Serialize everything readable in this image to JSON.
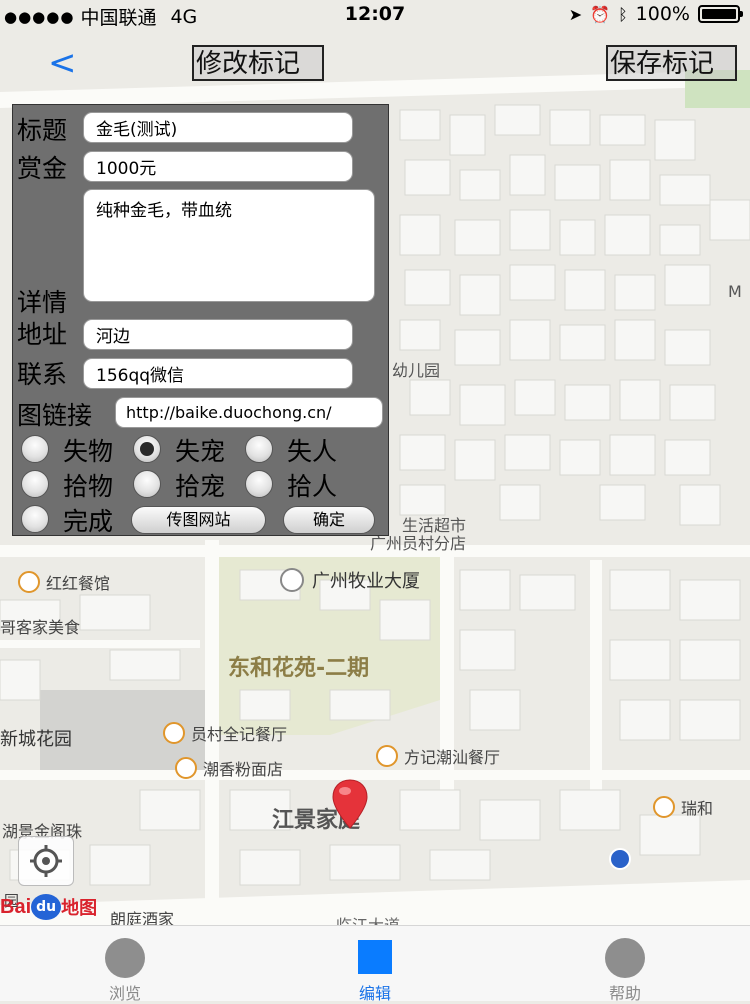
{
  "status_bar": {
    "carrier": "中国联通",
    "network": "4G",
    "time": "12:07",
    "battery": "100%"
  },
  "nav": {
    "back_label": "<",
    "modify_label": "修改标记",
    "save_label": "保存标记"
  },
  "form": {
    "title_label": "标题",
    "title_value": "金毛(测试)",
    "reward_label": "赏金",
    "reward_value": "1000元",
    "detail_label": "详情",
    "detail_value": "纯种金毛，带血统",
    "address_label": "地址",
    "address_value": "河边",
    "contact_label": "联系",
    "contact_value": "156qq微信",
    "image_link_label": "图链接",
    "image_link_value": "http://baike.duochong.cn/",
    "radio_options": [
      "失物",
      "失宠",
      "失人",
      "拾物",
      "拾宠",
      "拾人",
      "完成"
    ],
    "selected_option": "失宠",
    "upload_button": "传图网站",
    "confirm_button": "确定"
  },
  "map": {
    "labels": {
      "kindergarten": "幼儿园",
      "supermarket_1": "生活超市",
      "supermarket_2": "广州员村分店",
      "honghong": "红红餐馆",
      "building": "广州牧业大厦",
      "hakka": "哥客家美食",
      "donghe": "东和花苑-二期",
      "xincheng": "新城花园",
      "quanji": "员村全记餐厅",
      "fangji": "方记潮汕餐厅",
      "chaoxiang": "潮香粉面店",
      "jiangjing": "江景家庭",
      "ruihe": "瑞和",
      "hujing": "湖景金阁珠",
      "tingjiujia": "朗庭酒家",
      "road": "临江大道",
      "garden_top": "园",
      "edge_m": "M",
      "baidu_logo": "Baidu地图"
    }
  },
  "tabbar": {
    "tabs": [
      {
        "label": "浏览"
      },
      {
        "label": "编辑"
      },
      {
        "label": "帮助"
      }
    ],
    "active_index": 1
  },
  "colors": {
    "accent": "#1a73e8",
    "form_bg": "#6f6f6f",
    "map_bg": "#ecebe6",
    "green_area": "#e6e9d2"
  }
}
